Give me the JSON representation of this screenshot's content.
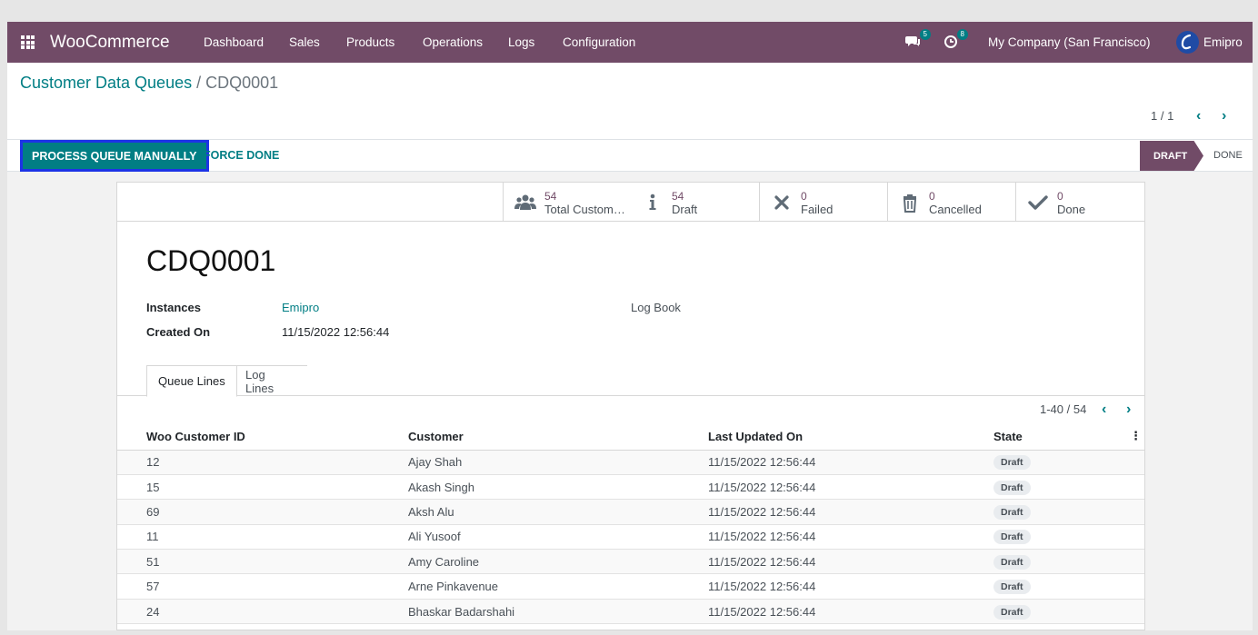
{
  "navbar": {
    "brand": "WooCommerce",
    "menu": [
      "Dashboard",
      "Sales",
      "Products",
      "Operations",
      "Logs",
      "Configuration"
    ],
    "messages_count": "5",
    "activities_count": "8",
    "company": "My Company (San Francisco)",
    "user": "Emipro",
    "color": "#714b67"
  },
  "breadcrumb": {
    "parent": "Customer Data Queues",
    "separator": " / ",
    "current": "CDQ0001"
  },
  "pager": {
    "value": "1 / 1"
  },
  "actions": {
    "process_label": "PROCESS QUEUE MANUALLY",
    "force_label": "FORCE DONE"
  },
  "stages": {
    "draft": "DRAFT",
    "done": "DONE"
  },
  "smart_buttons": [
    {
      "icon": "users-icon",
      "value": "54",
      "label": "Total Customers"
    },
    {
      "icon": "info-icon",
      "value": "54",
      "label": "Draft"
    },
    {
      "icon": "times-icon",
      "value": "0",
      "label": "Failed"
    },
    {
      "icon": "trash-icon",
      "value": "0",
      "label": "Cancelled"
    },
    {
      "icon": "check-icon",
      "value": "0",
      "label": "Done"
    }
  ],
  "record": {
    "name": "CDQ0001",
    "instances_label": "Instances",
    "instances_value": "Emipro",
    "created_label": "Created On",
    "created_value": "11/15/2022 12:56:44",
    "logbook_label": "Log Book"
  },
  "tabs": [
    "Queue Lines",
    "Log Lines"
  ],
  "list": {
    "pager": "1-40 / 54",
    "columns": [
      "Woo Customer ID",
      "Customer",
      "Last Updated On",
      "State"
    ],
    "rows": [
      {
        "id": "12",
        "customer": "Ajay Shah",
        "updated": "11/15/2022 12:56:44",
        "state": "Draft"
      },
      {
        "id": "15",
        "customer": "Akash Singh",
        "updated": "11/15/2022 12:56:44",
        "state": "Draft"
      },
      {
        "id": "69",
        "customer": "Aksh Alu",
        "updated": "11/15/2022 12:56:44",
        "state": "Draft"
      },
      {
        "id": "11",
        "customer": "Ali Yusoof",
        "updated": "11/15/2022 12:56:44",
        "state": "Draft"
      },
      {
        "id": "51",
        "customer": "Amy Caroline",
        "updated": "11/15/2022 12:56:44",
        "state": "Draft"
      },
      {
        "id": "57",
        "customer": "Arne Pinkavenue",
        "updated": "11/15/2022 12:56:44",
        "state": "Draft"
      },
      {
        "id": "24",
        "customer": "Bhaskar Badarshahi",
        "updated": "11/15/2022 12:56:44",
        "state": "Draft"
      }
    ]
  }
}
